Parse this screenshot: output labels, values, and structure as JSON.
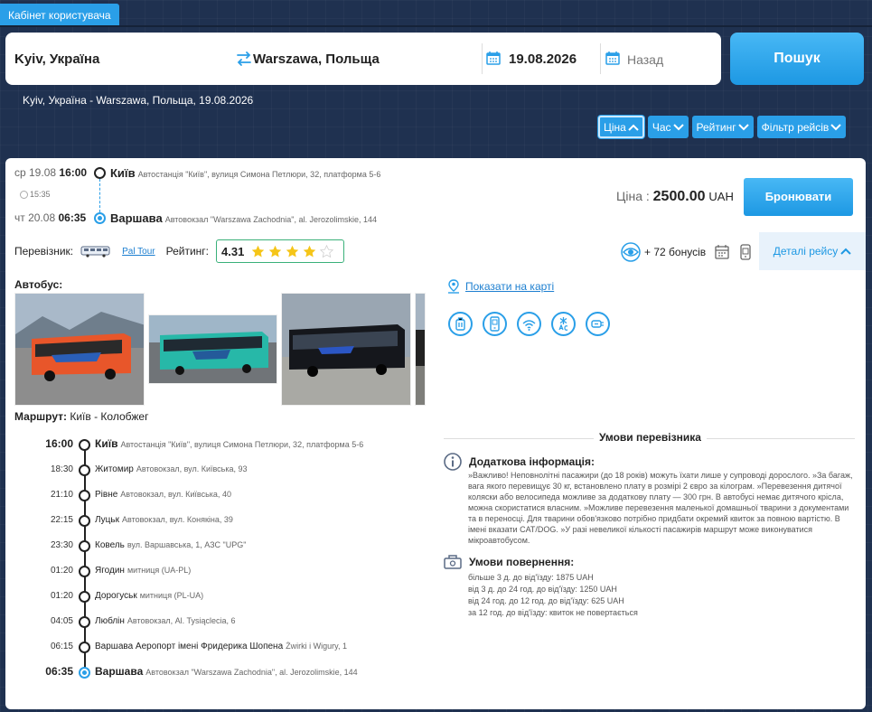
{
  "header": {
    "cabinet_tab": "Кабінет користувача"
  },
  "search": {
    "from": "Kyiv, Україна",
    "to": "Warszawa, Польща",
    "date": "19.08.2026",
    "back_placeholder": "Назад",
    "search_button": "Пошук"
  },
  "route_summary": "Kyiv, Україна - Warszawa, Польща, 19.08.2026",
  "sort": {
    "price": "Ціна",
    "time": "Час",
    "rating": "Рейтинг",
    "filter": "Фільтр рейсів"
  },
  "trip": {
    "departure": {
      "day_date": "ср 19.08",
      "time": "16:00",
      "city": "Київ",
      "address": "Автостанція \"Київ\", вулиця Симона Петлюри, 32, платформа 5-6"
    },
    "duration": "15:35",
    "arrival": {
      "day_date": "чт 20.08",
      "time": "06:35",
      "city": "Варшава",
      "address": "Автовокзал \"Warszawa Zachodnia\", al. Jerozolimskie, 144"
    },
    "price_label": "Ціна :",
    "price_value": "2500.00",
    "currency": "UAH",
    "book_button": "Бронювати",
    "carrier_label": "Перевізник:",
    "carrier_name": "Pal Tour",
    "rating_label": "Рейтинг:",
    "rating_value": "4.31",
    "rating_stars": 4.31,
    "bonus_text": "+ 72 бонусів",
    "details_button": "Деталі рейсу",
    "bus_label": "Автобус:",
    "map_link": "Показати на карті",
    "route_label": "Маршрут:",
    "route_name": "Київ - Колобжег"
  },
  "stops": [
    {
      "time": "16:00",
      "city": "Київ",
      "address": "Автостанція \"Київ\", вулиця Симона Петлюри, 32, платформа 5-6",
      "major": true
    },
    {
      "time": "18:30",
      "city": "Житомир",
      "address": "Автовокзал, вул. Київська, 93",
      "major": false
    },
    {
      "time": "21:10",
      "city": "Рівне",
      "address": "Автовокзал, вул. Київська, 40",
      "major": false
    },
    {
      "time": "22:15",
      "city": "Луцьк",
      "address": "Автовокзал, вул. Конякіна, 39",
      "major": false
    },
    {
      "time": "23:30",
      "city": "Ковель",
      "address": "вул. Варшавська, 1, АЗС \"UPG\"",
      "major": false
    },
    {
      "time": "01:20",
      "city": "Ягодин",
      "address": "митниця (UA-PL)",
      "major": false
    },
    {
      "time": "01:20",
      "city": "Дорогуськ",
      "address": "митниця (PL-UA)",
      "major": false
    },
    {
      "time": "04:05",
      "city": "Люблін",
      "address": "Автовокзал, Al. Tysiąclecia, 6",
      "major": false
    },
    {
      "time": "06:15",
      "city": "Варшава Аеропорт імені Фридерика Шопена",
      "address": "Żwirki i Wigury, 1",
      "major": false
    },
    {
      "time": "06:35",
      "city": "Варшава",
      "address": "Автовокзал \"Warszawa Zachodnia\", al. Jerozolimskie, 144",
      "major": true
    }
  ],
  "conditions": {
    "title": "Умови перевізника",
    "info_title": "Додаткова інформація:",
    "info_text": "»Важливо! Неповнолітні пасажири (до 18 років) можуть їхати лише у супроводі дорослого. »За багаж, вага якого перевищує 30 кг, встановлено плату в розмірі 2 євро за кілограм. »Перевезення дитячої коляски або велосипеда можливе за додаткову плату — 300 грн. В автобусі немає дитячого крісла, можна скористатися власним. »Можливе перевезення маленької домашньої тварини з документами та в переносці. Для тварини обов'язково потрібно придбати окремий квиток за повною вартістю. В імені вказати CAT/DOG. »У разі невеликої кількості пасажирів маршрут може виконуватися мікроавтобусом.",
    "refund_title": "Умови повернення:",
    "refund_items": [
      "більше 3 д. до від'їзду: 1875 UAH",
      "від 3 д. до 24 год. до від'їзду: 1250 UAH",
      "від 24 год. до 12 год. до від'їзду: 625 UAH",
      "за 12 год. до від'їзду: квиток не повертається"
    ]
  },
  "colors": {
    "accent": "#2a9fe8",
    "background": "#1f3150",
    "star": "#f5c518"
  }
}
